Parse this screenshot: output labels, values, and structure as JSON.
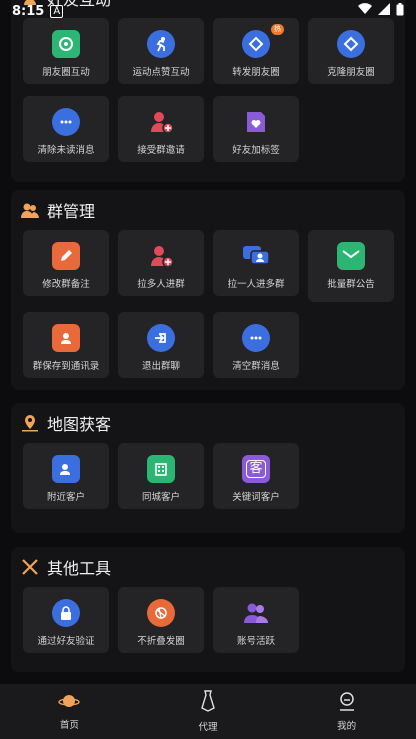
{
  "status_bar": {
    "time": "8:15",
    "indicator": "A"
  },
  "sections": {
    "friend_interact": {
      "title": "好友互动",
      "items": [
        {
          "label": "朋友圈互动",
          "icon": "moments-chat-icon",
          "color": "#2bb673"
        },
        {
          "label": "运动点赞互动",
          "icon": "running-icon",
          "color": "#3b6fe0"
        },
        {
          "label": "转发朋友圈",
          "icon": "forward-moments-icon",
          "color": "#3b6fe0",
          "badge": "热"
        },
        {
          "label": "克隆朋友圈",
          "icon": "clone-moments-icon",
          "color": "#3b6fe0"
        },
        {
          "label": "清除未读消息",
          "icon": "chat-dots-icon",
          "color": "#3b6fe0"
        },
        {
          "label": "接受群邀请",
          "icon": "add-user-icon",
          "color": "#e04a5a"
        },
        {
          "label": "好友加标签",
          "icon": "tag-heart-icon",
          "color": "#8a5ad8"
        }
      ]
    },
    "group_manage": {
      "title": "群管理",
      "items": [
        {
          "label": "修改群备注",
          "icon": "edit-icon",
          "color": "#e8693a"
        },
        {
          "label": "拉多人进群",
          "icon": "add-users-icon",
          "color": "#e04a5a"
        },
        {
          "label": "拉一人进多群",
          "icon": "chat-user-icon",
          "color": "#3b6fe0"
        },
        {
          "label": "批量群公告",
          "icon": "mail-icon",
          "color": "#2bb673"
        },
        {
          "label": "群保存到通讯录",
          "icon": "contacts-icon",
          "color": "#e8693a"
        },
        {
          "label": "退出群聊",
          "icon": "exit-chat-icon",
          "color": "#3b6fe0"
        },
        {
          "label": "清空群消息",
          "icon": "chat-dots-icon",
          "color": "#3b6fe0"
        }
      ]
    },
    "map_customers": {
      "title": "地图获客",
      "items": [
        {
          "label": "附近客户",
          "icon": "nearby-contact-icon",
          "color": "#3b6fe0"
        },
        {
          "label": "同城客户",
          "icon": "city-building-icon",
          "color": "#2bb673"
        },
        {
          "label": "关键词客户",
          "icon": "keyword-customer-icon",
          "color": "#8a5ad8",
          "glyph": "客"
        }
      ]
    },
    "other_tools": {
      "title": "其他工具",
      "items": [
        {
          "label": "通过好友验证",
          "icon": "lock-icon",
          "color": "#3b6fe0"
        },
        {
          "label": "不折叠发圈",
          "icon": "fold-icon",
          "color": "#e8693a"
        },
        {
          "label": "账号活跃",
          "icon": "users-icon",
          "color": "#8a5ad8"
        }
      ]
    }
  },
  "bottom_nav": [
    {
      "label": "首页",
      "icon": "planet-icon"
    },
    {
      "label": "代理",
      "icon": "tie-icon"
    },
    {
      "label": "我的",
      "icon": "profile-icon"
    }
  ]
}
